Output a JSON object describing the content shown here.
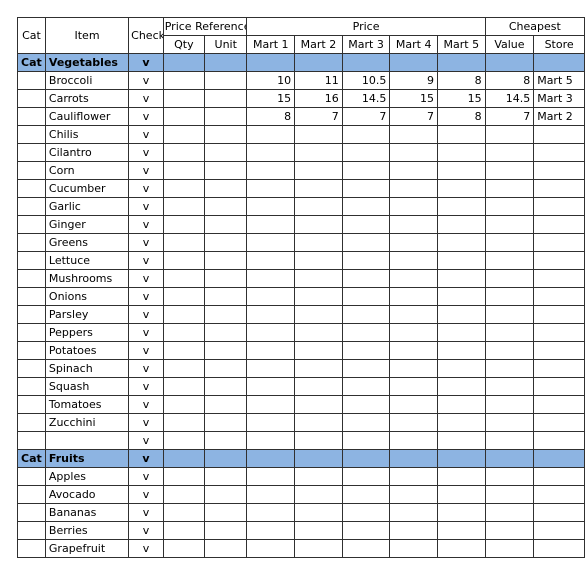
{
  "sheet": {
    "header": {
      "group_row": [
        {
          "label": "Cat",
          "key": "cat"
        },
        {
          "label": "Item",
          "key": "item"
        },
        {
          "label": "Checklist",
          "key": "checklist"
        },
        {
          "label": "Price Reference",
          "key": "price_reference"
        },
        {
          "label": "Price",
          "key": "price"
        },
        {
          "label": "Cheapest",
          "key": "cheapest"
        }
      ],
      "sub_row": {
        "qty": "Qty",
        "unit": "Unit",
        "mart1": "Mart 1",
        "mart2": "Mart 2",
        "mart3": "Mart 3",
        "mart4": "Mart 4",
        "mart5": "Mart 5",
        "value": "Value",
        "store": "Store"
      }
    },
    "check_mark": "v",
    "cat_label": "Cat",
    "colors": {
      "category_row": "#8DB4E2",
      "cheapest_highlight": "#CCFFFF",
      "border": "#303030",
      "background": "#FFFFFF"
    },
    "rows": [
      {
        "type": "category",
        "cat": "Cat",
        "item": "Vegetables",
        "checklist": "v"
      },
      {
        "type": "item",
        "item": "Broccoli",
        "checklist": "v",
        "qty": "",
        "unit": "",
        "mart1": "10",
        "mart2": "11",
        "mart3": "10.5",
        "mart4": "9",
        "mart5": "8",
        "cheap_marts": [
          "mart5"
        ],
        "value": "8",
        "store": "Mart 5"
      },
      {
        "type": "item",
        "item": "Carrots",
        "checklist": "v",
        "qty": "",
        "unit": "",
        "mart1": "15",
        "mart2": "16",
        "mart3": "14.5",
        "mart4": "15",
        "mart5": "15",
        "cheap_marts": [
          "mart3"
        ],
        "value": "14.5",
        "store": "Mart 3"
      },
      {
        "type": "item",
        "item": "Cauliflower",
        "checklist": "v",
        "qty": "",
        "unit": "",
        "mart1": "8",
        "mart2": "7",
        "mart3": "7",
        "mart4": "7",
        "mart5": "8",
        "cheap_marts": [
          "mart2",
          "mart3",
          "mart4"
        ],
        "value": "7",
        "store": "Mart 2"
      },
      {
        "type": "item",
        "item": "Chilis",
        "checklist": "v",
        "qty": "",
        "unit": "",
        "mart1": "",
        "mart2": "",
        "mart3": "",
        "mart4": "",
        "mart5": "",
        "cheap_marts": [],
        "value": "",
        "store": ""
      },
      {
        "type": "item",
        "item": "Cilantro",
        "checklist": "v",
        "qty": "",
        "unit": "",
        "mart1": "",
        "mart2": "",
        "mart3": "",
        "mart4": "",
        "mart5": "",
        "cheap_marts": [],
        "value": "",
        "store": ""
      },
      {
        "type": "item",
        "item": "Corn",
        "checklist": "v",
        "qty": "",
        "unit": "",
        "mart1": "",
        "mart2": "",
        "mart3": "",
        "mart4": "",
        "mart5": "",
        "cheap_marts": [],
        "value": "",
        "store": ""
      },
      {
        "type": "item",
        "item": "Cucumber",
        "checklist": "v",
        "qty": "",
        "unit": "",
        "mart1": "",
        "mart2": "",
        "mart3": "",
        "mart4": "",
        "mart5": "",
        "cheap_marts": [],
        "value": "",
        "store": ""
      },
      {
        "type": "item",
        "item": "Garlic",
        "checklist": "v",
        "qty": "",
        "unit": "",
        "mart1": "",
        "mart2": "",
        "mart3": "",
        "mart4": "",
        "mart5": "",
        "cheap_marts": [],
        "value": "",
        "store": ""
      },
      {
        "type": "item",
        "item": "Ginger",
        "checklist": "v",
        "qty": "",
        "unit": "",
        "mart1": "",
        "mart2": "",
        "mart3": "",
        "mart4": "",
        "mart5": "",
        "cheap_marts": [],
        "value": "",
        "store": ""
      },
      {
        "type": "item",
        "item": "Greens",
        "checklist": "v",
        "qty": "",
        "unit": "",
        "mart1": "",
        "mart2": "",
        "mart3": "",
        "mart4": "",
        "mart5": "",
        "cheap_marts": [],
        "value": "",
        "store": ""
      },
      {
        "type": "item",
        "item": "Lettuce",
        "checklist": "v",
        "qty": "",
        "unit": "",
        "mart1": "",
        "mart2": "",
        "mart3": "",
        "mart4": "",
        "mart5": "",
        "cheap_marts": [],
        "value": "",
        "store": ""
      },
      {
        "type": "item",
        "item": "Mushrooms",
        "checklist": "v",
        "qty": "",
        "unit": "",
        "mart1": "",
        "mart2": "",
        "mart3": "",
        "mart4": "",
        "mart5": "",
        "cheap_marts": [],
        "value": "",
        "store": ""
      },
      {
        "type": "item",
        "item": "Onions",
        "checklist": "v",
        "qty": "",
        "unit": "",
        "mart1": "",
        "mart2": "",
        "mart3": "",
        "mart4": "",
        "mart5": "",
        "cheap_marts": [],
        "value": "",
        "store": ""
      },
      {
        "type": "item",
        "item": "Parsley",
        "checklist": "v",
        "qty": "",
        "unit": "",
        "mart1": "",
        "mart2": "",
        "mart3": "",
        "mart4": "",
        "mart5": "",
        "cheap_marts": [],
        "value": "",
        "store": ""
      },
      {
        "type": "item",
        "item": "Peppers",
        "checklist": "v",
        "qty": "",
        "unit": "",
        "mart1": "",
        "mart2": "",
        "mart3": "",
        "mart4": "",
        "mart5": "",
        "cheap_marts": [],
        "value": "",
        "store": ""
      },
      {
        "type": "item",
        "item": "Potatoes",
        "checklist": "v",
        "qty": "",
        "unit": "",
        "mart1": "",
        "mart2": "",
        "mart3": "",
        "mart4": "",
        "mart5": "",
        "cheap_marts": [],
        "value": "",
        "store": ""
      },
      {
        "type": "item",
        "item": "Spinach",
        "checklist": "v",
        "qty": "",
        "unit": "",
        "mart1": "",
        "mart2": "",
        "mart3": "",
        "mart4": "",
        "mart5": "",
        "cheap_marts": [],
        "value": "",
        "store": ""
      },
      {
        "type": "item",
        "item": "Squash",
        "checklist": "v",
        "qty": "",
        "unit": "",
        "mart1": "",
        "mart2": "",
        "mart3": "",
        "mart4": "",
        "mart5": "",
        "cheap_marts": [],
        "value": "",
        "store": ""
      },
      {
        "type": "item",
        "item": "Tomatoes",
        "checklist": "v",
        "qty": "",
        "unit": "",
        "mart1": "",
        "mart2": "",
        "mart3": "",
        "mart4": "",
        "mart5": "",
        "cheap_marts": [],
        "value": "",
        "store": ""
      },
      {
        "type": "item",
        "item": "Zucchini",
        "checklist": "v",
        "qty": "",
        "unit": "",
        "mart1": "",
        "mart2": "",
        "mart3": "",
        "mart4": "",
        "mart5": "",
        "cheap_marts": [],
        "value": "",
        "store": ""
      },
      {
        "type": "item",
        "item": "",
        "checklist": "v",
        "qty": "",
        "unit": "",
        "mart1": "",
        "mart2": "",
        "mart3": "",
        "mart4": "",
        "mart5": "",
        "cheap_marts": [],
        "value": "",
        "store": ""
      },
      {
        "type": "category",
        "cat": "Cat",
        "item": "Fruits",
        "checklist": "v"
      },
      {
        "type": "item",
        "item": "Apples",
        "checklist": "v",
        "qty": "",
        "unit": "",
        "mart1": "",
        "mart2": "",
        "mart3": "",
        "mart4": "",
        "mart5": "",
        "cheap_marts": [],
        "value": "",
        "store": ""
      },
      {
        "type": "item",
        "item": "Avocado",
        "checklist": "v",
        "qty": "",
        "unit": "",
        "mart1": "",
        "mart2": "",
        "mart3": "",
        "mart4": "",
        "mart5": "",
        "cheap_marts": [],
        "value": "",
        "store": ""
      },
      {
        "type": "item",
        "item": "Bananas",
        "checklist": "v",
        "qty": "",
        "unit": "",
        "mart1": "",
        "mart2": "",
        "mart3": "",
        "mart4": "",
        "mart5": "",
        "cheap_marts": [],
        "value": "",
        "store": ""
      },
      {
        "type": "item",
        "item": "Berries",
        "checklist": "v",
        "qty": "",
        "unit": "",
        "mart1": "",
        "mart2": "",
        "mart3": "",
        "mart4": "",
        "mart5": "",
        "cheap_marts": [],
        "value": "",
        "store": ""
      },
      {
        "type": "item",
        "item": "Grapefruit",
        "checklist": "v",
        "qty": "",
        "unit": "",
        "mart1": "",
        "mart2": "",
        "mart3": "",
        "mart4": "",
        "mart5": "",
        "cheap_marts": [],
        "value": "",
        "store": ""
      }
    ]
  }
}
